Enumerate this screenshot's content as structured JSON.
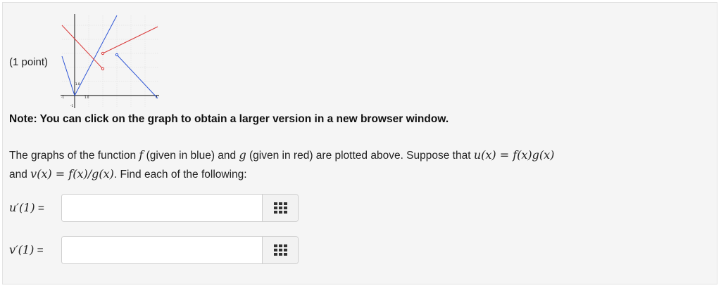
{
  "problem": {
    "points": "(1 point)",
    "note": "Note: You can click on the graph to obtain a larger version in a new browser window.",
    "para_1a": "The graphs of the function ",
    "f": "f",
    "para_1b": " (given in blue) and ",
    "g": "g",
    "para_1c": " (given in red) are plotted above. Suppose that ",
    "u_eq": "u(x) = f(x)g(x)",
    "para_2a": "and ",
    "v_eq": "v(x) = f(x)/g(x)",
    "para_2b": ". Find each of the following:"
  },
  "graph": {
    "tick_labels": [
      "1.0",
      "-1",
      "1.0",
      "-1",
      "4"
    ]
  },
  "answers": [
    {
      "label_math": "u′(1)",
      "label_eq": " =",
      "value": "",
      "keyboard_icon": "keypad-icon"
    },
    {
      "label_math": "v′(1)",
      "label_eq": " =",
      "value": "",
      "keyboard_icon": "keypad-icon"
    }
  ],
  "colors": {
    "blue": "#2f56d6",
    "red": "#d93a3a"
  }
}
